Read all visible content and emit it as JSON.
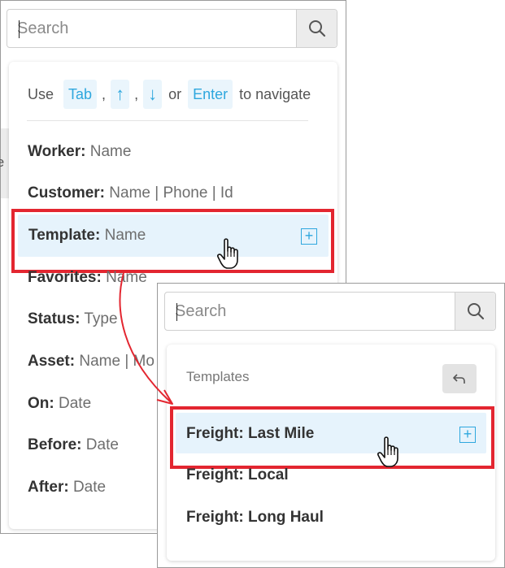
{
  "main_panel": {
    "search": {
      "placeholder": "Search"
    },
    "hint": {
      "use": "Use",
      "keys": [
        "Tab",
        "↑",
        "↓",
        "Enter"
      ],
      "sep1": ",",
      "sep2": ",",
      "or": "or",
      "suffix": "to navigate"
    },
    "items": [
      {
        "label": "Worker:",
        "value": " Name"
      },
      {
        "label": "Customer:",
        "value": " Name | Phone | Id"
      },
      {
        "label": "Template:",
        "value": " Name"
      },
      {
        "label": "Favorites:",
        "value": " Name"
      },
      {
        "label": "Status:",
        "value": " Type"
      },
      {
        "label": "Asset:",
        "value": " Name | Mo"
      },
      {
        "label": "On:",
        "value": " Date"
      },
      {
        "label": "Before:",
        "value": " Date"
      },
      {
        "label": "After:",
        "value": " Date"
      }
    ],
    "background_fragment": "te"
  },
  "templates_panel": {
    "search": {
      "placeholder": "Search"
    },
    "section_title": "Templates",
    "items": [
      "Freight: Last Mile",
      "Freight: Local",
      "Freight: Long Haul"
    ]
  },
  "colors": {
    "accent": "#2ea7de",
    "highlight": "#e6f3fc",
    "annotation_red": "#e32630"
  }
}
